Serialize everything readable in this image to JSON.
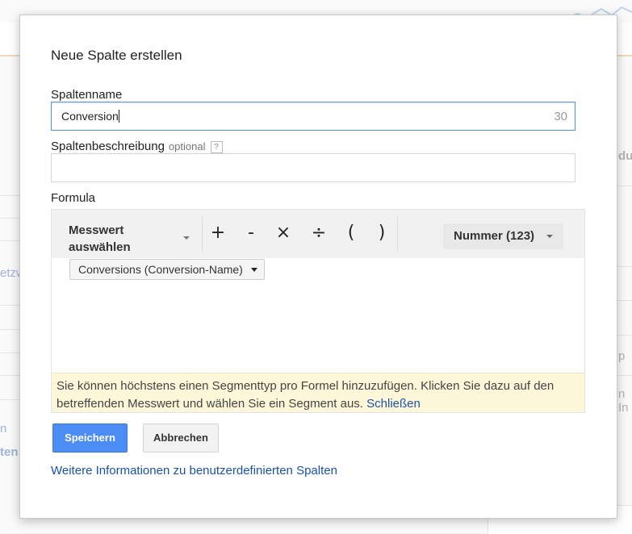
{
  "background": {
    "left_fragments": [
      "etzw",
      "n",
      "ten"
    ],
    "right_fragments": [
      "du",
      "p",
      "n In"
    ]
  },
  "dialog": {
    "title": "Neue Spalte erstellen",
    "column_name": {
      "label": "Spaltenname",
      "value": "Conversion",
      "remaining_chars": "30"
    },
    "column_description": {
      "label": "Spaltenbeschreibung",
      "optional_label": "optional",
      "help_icon_text": "?",
      "value": ""
    },
    "formula": {
      "label": "Formula",
      "metric_select": {
        "line1": "Messwert",
        "line2": "auswählen"
      },
      "operators": [
        "+",
        "-",
        "×",
        "÷",
        "(",
        ")"
      ],
      "format_select": "Nummer (123)",
      "chips": [
        {
          "label": "Conversions (Conversion-Name)"
        }
      ],
      "notice": {
        "text": "Sie können höchstens einen Segmenttyp pro Formel hinzuzufügen. Klicken Sie dazu auf den betreffenden Messwert und wählen Sie ein Segment aus.",
        "link": "Schließen"
      }
    },
    "buttons": {
      "save": "Speichern",
      "cancel": "Abbrechen"
    },
    "more_info_link": "Weitere Informationen zu benutzerdefinierten Spalten"
  },
  "colors": {
    "primary_button": "#4c8cf5",
    "link": "#1a52a8",
    "notice_bg": "#fdf7d9",
    "focus_border": "#4d90fe"
  }
}
